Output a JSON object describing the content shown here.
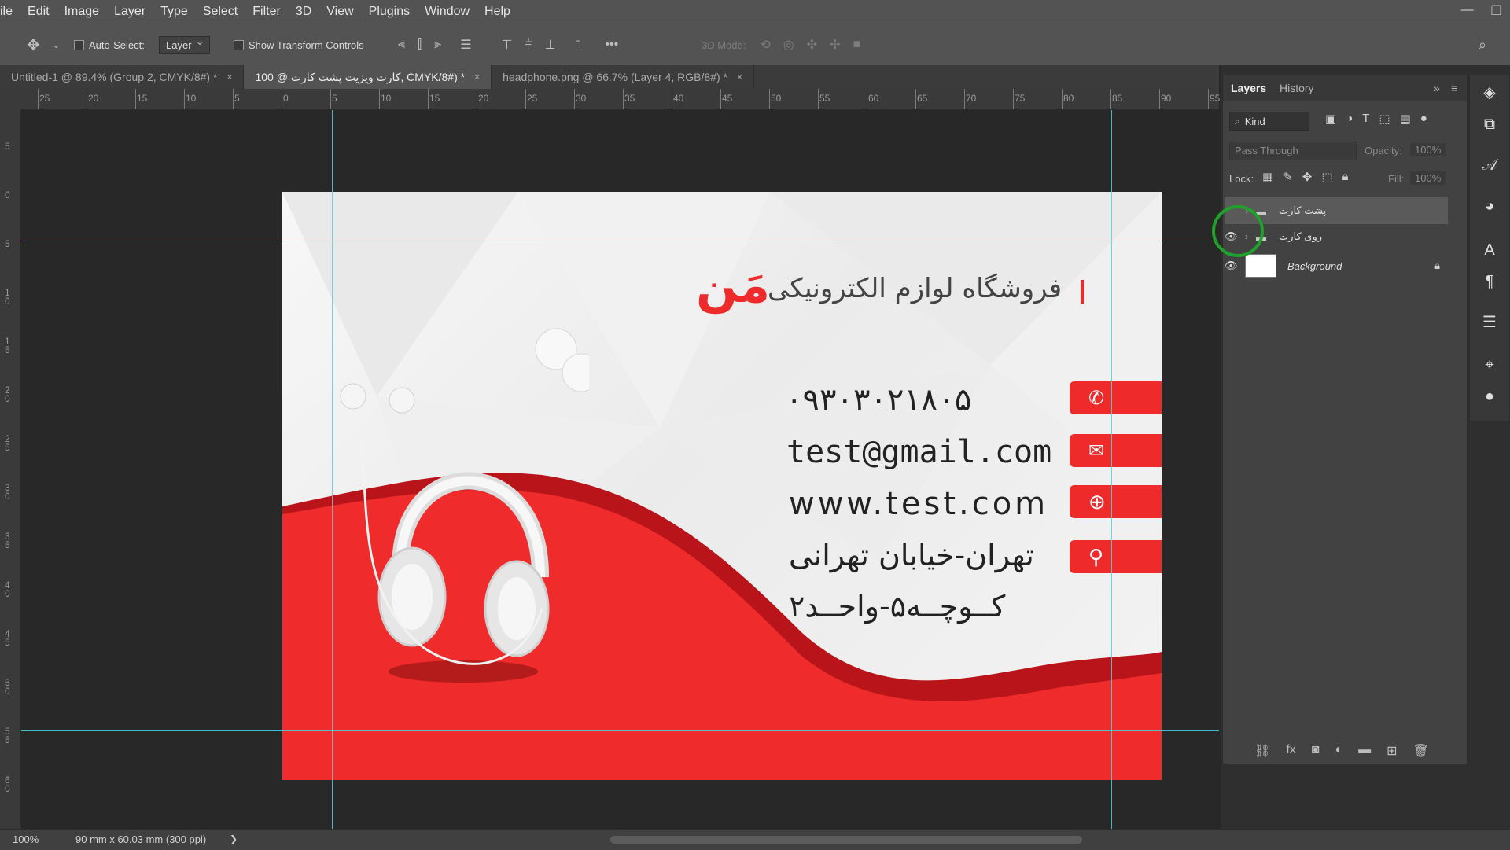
{
  "menu": [
    "ile",
    "Edit",
    "Image",
    "Layer",
    "Type",
    "Select",
    "Filter",
    "3D",
    "View",
    "Plugins",
    "Window",
    "Help"
  ],
  "options": {
    "auto_select_label": "Auto-Select:",
    "auto_select_value": "Layer",
    "show_transform_label": "Show Transform Controls",
    "more_label": "•••",
    "mode_3d_label": "3D Mode:"
  },
  "tabs": [
    {
      "label": "Untitled-1 @ 89.4% (Group 2, CMYK/8#) *",
      "close": "×"
    },
    {
      "label": "100 @ کارت ویزیت پشت کارت, CMYK/8#) *",
      "close": "×"
    },
    {
      "label": "headphone.png @ 66.7% (Layer 4, RGB/8#) *",
      "close": "×"
    }
  ],
  "ruler_top": [
    "25",
    "20",
    "15",
    "10",
    "5",
    "0",
    "5",
    "10",
    "15",
    "20",
    "25",
    "30",
    "35",
    "40",
    "45",
    "50",
    "55",
    "60",
    "65",
    "70",
    "75",
    "80",
    "85",
    "90",
    "95"
  ],
  "ruler_left": [
    "5",
    "0",
    "5",
    "1\n0",
    "1\n5",
    "2\n0",
    "2\n5",
    "3\n0",
    "3\n5",
    "4\n0",
    "4\n5",
    "5\n0",
    "5\n5",
    "6\n0"
  ],
  "card": {
    "store_title": "فروشگاه لوازم الکترونیکی",
    "brand": "مَن",
    "phone": "۰۹۳۰۳۰۲۱۸۰۵",
    "email": "test@gmail.com",
    "website": "www.test.com",
    "address_line1": "تهران-خیابان تهرانی",
    "address_line2": "کــوچــه۵-واحــد۲",
    "accent": "#ee2a2a"
  },
  "status": {
    "zoom": "100%",
    "doc_info": "90 mm x 60.03 mm (300 ppi)",
    "arrow": "❯"
  },
  "layers_panel": {
    "tab_layers": "Layers",
    "tab_history": "History",
    "filter_kind": "Kind",
    "blend_mode": "Pass Through",
    "opacity_label": "Opacity:",
    "opacity_value": "100%",
    "lock_label": "Lock:",
    "fill_label": "Fill:",
    "fill_value": "100%",
    "layers": [
      {
        "name": "پشت کارت",
        "type": "group",
        "visible": false
      },
      {
        "name": "روی کارت",
        "type": "group",
        "visible": true
      },
      {
        "name": "Background",
        "type": "pixel",
        "visible": true,
        "locked": true
      }
    ]
  },
  "colors": {
    "accent_red": "#ee2a2a",
    "guide": "#3fd7e6",
    "cursor_ring": "#1fa12c"
  }
}
